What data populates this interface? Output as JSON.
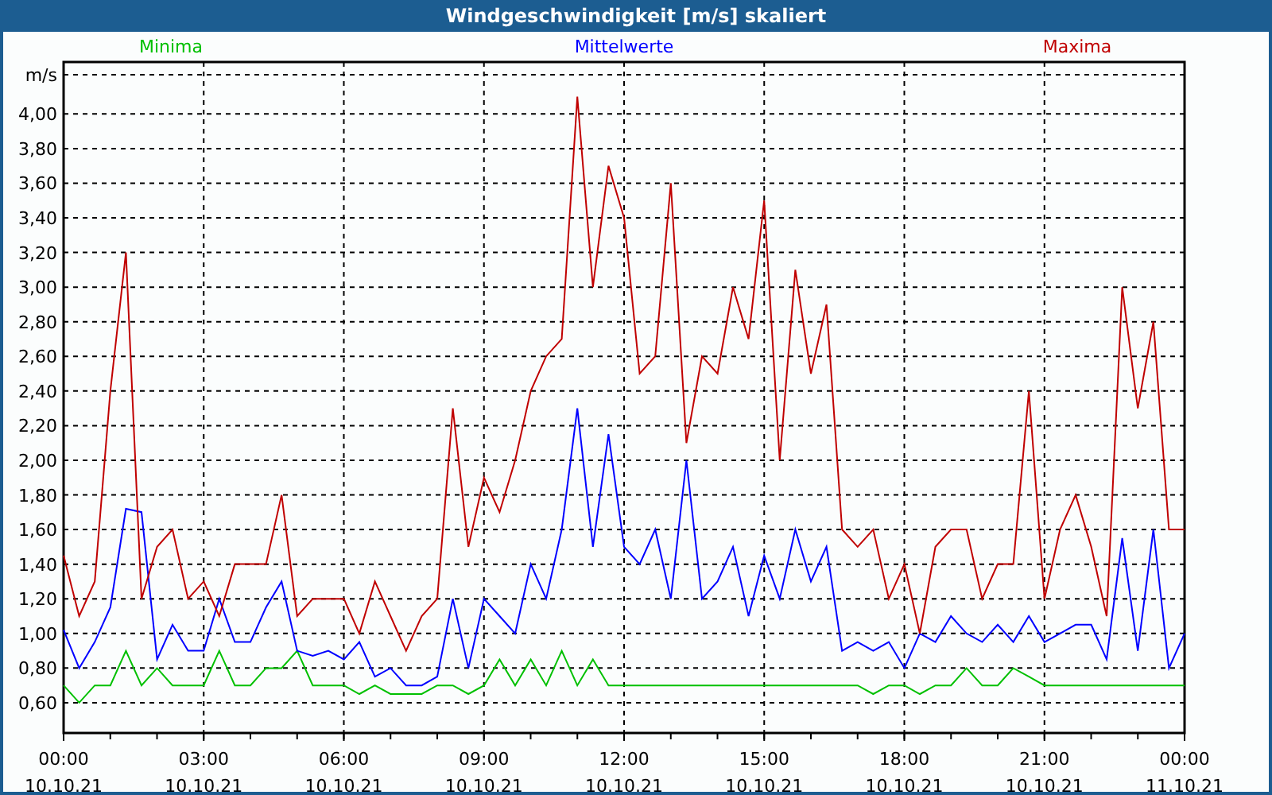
{
  "window": {
    "title": "Windgeschwindigkeit [m/s] skaliert"
  },
  "chart_data": {
    "type": "line",
    "grid": true,
    "ylabel": "m/s",
    "ylim": [
      0.425,
      4.3
    ],
    "categories": [
      "00:00 10.10.21",
      null,
      null,
      null,
      null,
      null,
      null,
      null,
      null,
      "03:00 10.10.21",
      null,
      null,
      null,
      null,
      null,
      null,
      null,
      null,
      "06:00 10.10.21",
      null,
      null,
      null,
      null,
      null,
      null,
      null,
      null,
      "09:00 10.10.21",
      null,
      null,
      null,
      null,
      null,
      null,
      null,
      null,
      "12:00 10.10.21",
      null,
      null,
      null,
      null,
      null,
      null,
      null,
      null,
      "15:00 10.10.21",
      null,
      null,
      null,
      null,
      null,
      null,
      null,
      null,
      "18:00 10.10.21",
      null,
      null,
      null,
      null,
      null,
      null,
      null,
      null,
      "21:00 10.10.21",
      null,
      null,
      null,
      null,
      null,
      null,
      null,
      null,
      "00:00 11.10.21"
    ],
    "series": [
      {
        "name": "Minima",
        "color": "#00c000",
        "values": [
          0.7,
          0.6,
          0.7,
          0.7,
          0.9,
          0.7,
          0.8,
          0.7,
          0.7,
          0.7,
          0.9,
          0.7,
          0.7,
          0.8,
          0.8,
          0.9,
          0.7,
          0.7,
          0.7,
          0.65,
          0.7,
          0.65,
          0.65,
          0.65,
          0.7,
          0.7,
          0.65,
          0.7,
          0.85,
          0.7,
          0.85,
          0.7,
          0.9,
          0.7,
          0.85,
          0.7,
          0.7,
          0.7,
          0.7,
          0.7,
          0.7,
          0.7,
          0.7,
          0.7,
          0.7,
          0.7,
          0.7,
          0.7,
          0.7,
          0.7,
          0.7,
          0.7,
          0.65,
          0.7,
          0.7,
          0.65,
          0.7,
          0.7,
          0.8,
          0.7,
          0.7,
          0.8,
          0.75,
          0.7,
          0.7,
          0.7,
          0.7,
          0.7,
          0.7,
          0.7,
          0.7,
          0.7,
          0.7
        ]
      },
      {
        "name": "Mittelwerte",
        "color": "#0000ff",
        "values": [
          1.02,
          0.8,
          0.95,
          1.15,
          1.72,
          1.7,
          0.85,
          1.05,
          0.9,
          0.9,
          1.2,
          0.95,
          0.95,
          1.15,
          1.3,
          0.9,
          0.87,
          0.9,
          0.85,
          0.95,
          0.75,
          0.8,
          0.7,
          0.7,
          0.75,
          1.2,
          0.8,
          1.2,
          1.1,
          1.0,
          1.4,
          1.2,
          1.6,
          2.3,
          1.5,
          2.15,
          1.5,
          1.4,
          1.6,
          1.2,
          2.0,
          1.2,
          1.3,
          1.5,
          1.1,
          1.45,
          1.2,
          1.6,
          1.3,
          1.5,
          0.9,
          0.95,
          0.9,
          0.95,
          0.8,
          1.0,
          0.95,
          1.1,
          1.0,
          0.95,
          1.05,
          0.95,
          1.1,
          0.95,
          1.0,
          1.05,
          1.05,
          0.85,
          1.55,
          0.9,
          1.6,
          0.8,
          1.0
        ]
      },
      {
        "name": "Maxima",
        "color": "#c00000",
        "values": [
          1.45,
          1.1,
          1.3,
          2.4,
          3.2,
          1.2,
          1.5,
          1.6,
          1.2,
          1.3,
          1.1,
          1.4,
          1.4,
          1.4,
          1.8,
          1.1,
          1.2,
          1.2,
          1.2,
          1.0,
          1.3,
          1.1,
          0.9,
          1.1,
          1.2,
          2.3,
          1.5,
          1.9,
          1.7,
          2.0,
          2.4,
          2.6,
          2.7,
          4.1,
          3.0,
          3.7,
          3.4,
          2.5,
          2.6,
          3.6,
          2.1,
          2.6,
          2.5,
          3.0,
          2.7,
          3.5,
          2.0,
          3.1,
          2.5,
          2.9,
          1.6,
          1.5,
          1.6,
          1.2,
          1.4,
          1.0,
          1.5,
          1.6,
          1.6,
          1.2,
          1.4,
          1.4,
          2.4,
          1.2,
          1.6,
          1.8,
          1.5,
          1.1,
          3.0,
          2.3,
          2.8,
          1.6,
          1.6
        ]
      }
    ],
    "yticks": [
      {
        "value": 0.6,
        "label": "0,60"
      },
      {
        "value": 0.8,
        "label": "0,80"
      },
      {
        "value": 1.0,
        "label": "1,00"
      },
      {
        "value": 1.2,
        "label": "1,20"
      },
      {
        "value": 1.4,
        "label": "1,40"
      },
      {
        "value": 1.6,
        "label": "1,60"
      },
      {
        "value": 1.8,
        "label": "1,80"
      },
      {
        "value": 2.0,
        "label": "2,00"
      },
      {
        "value": 2.2,
        "label": "2,20"
      },
      {
        "value": 2.4,
        "label": "2,40"
      },
      {
        "value": 2.6,
        "label": "2,60"
      },
      {
        "value": 2.8,
        "label": "2,80"
      },
      {
        "value": 3.0,
        "label": "3,00"
      },
      {
        "value": 3.2,
        "label": "3,20"
      },
      {
        "value": 3.4,
        "label": "3,40"
      },
      {
        "value": 3.6,
        "label": "3,60"
      },
      {
        "value": 3.8,
        "label": "3,80"
      },
      {
        "value": 4.0,
        "label": "4,00"
      }
    ]
  }
}
